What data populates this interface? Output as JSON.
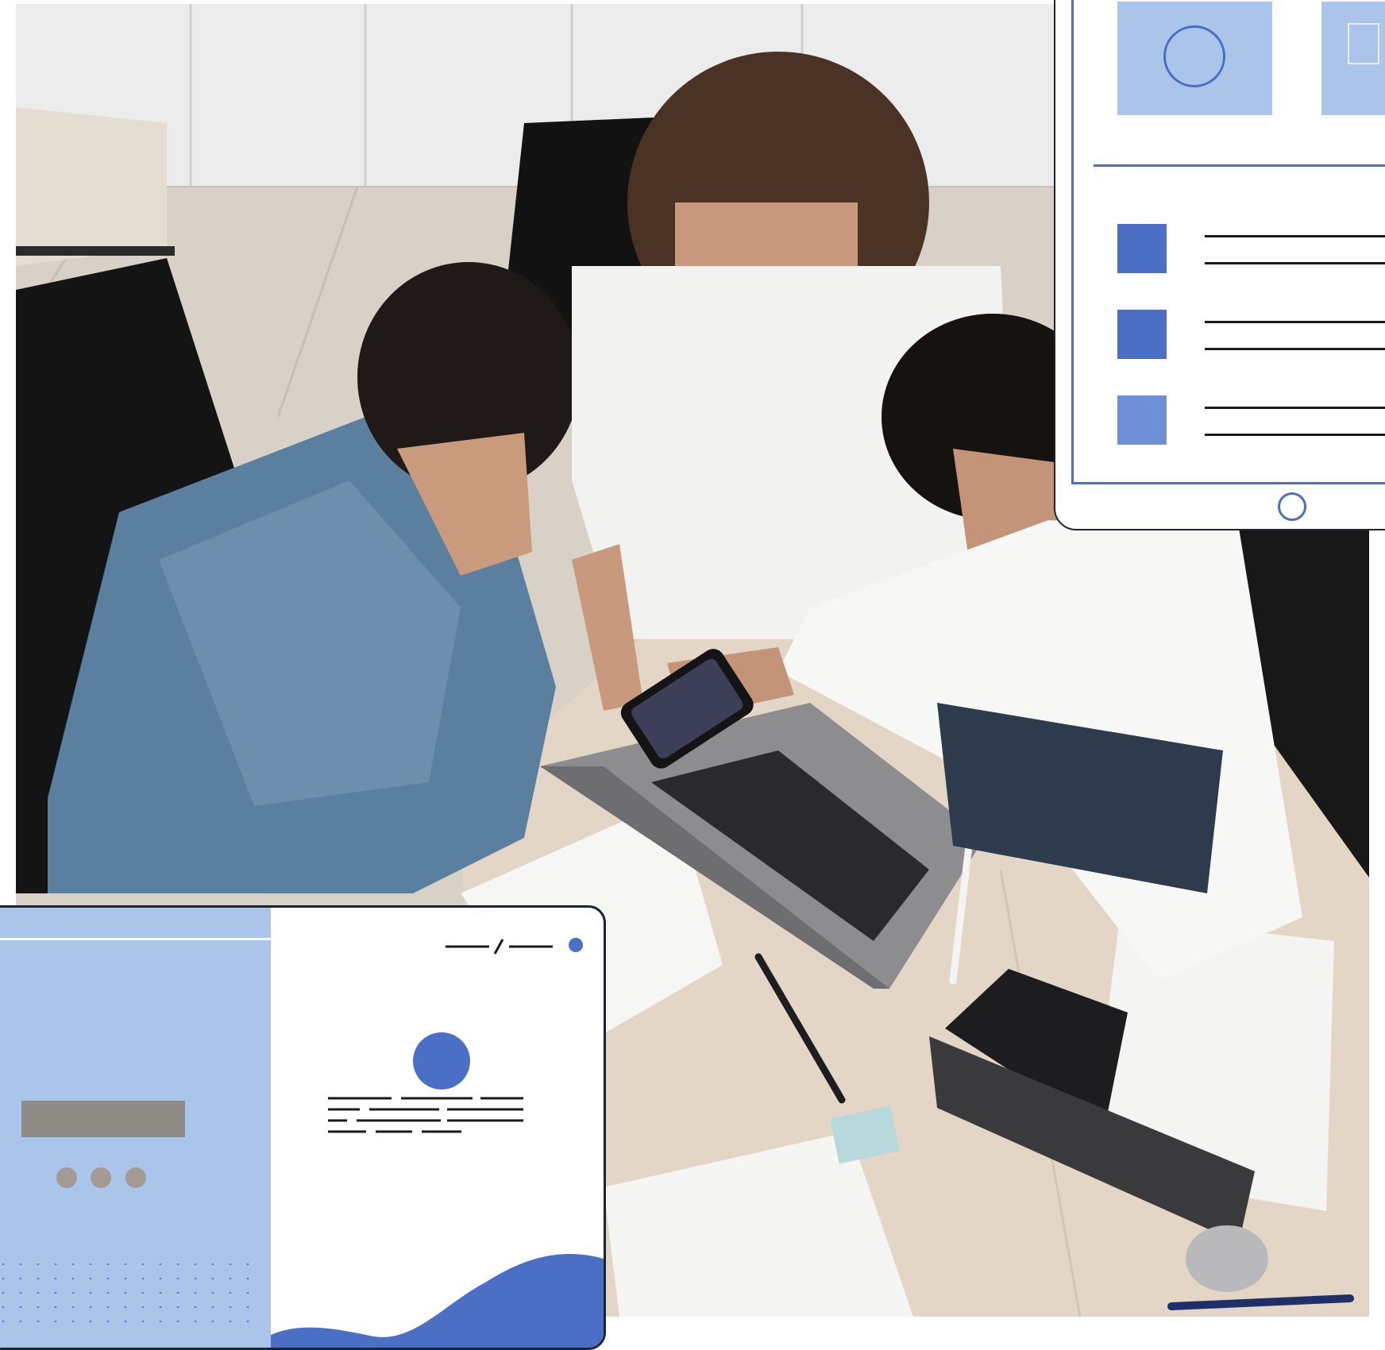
{
  "scene": {
    "description_tags": [
      "office-meeting-photo",
      "tablet-mockup",
      "laptop-mockup"
    ]
  },
  "colors": {
    "accent_blue": "#4b6fc4",
    "light_blue": "#aac5e9",
    "ink": "#1b1b1b",
    "frame": "#1d2330"
  },
  "tablet_mockup": {
    "rows": [
      {
        "square_color": "#4b6fc4"
      },
      {
        "square_color": "#4b6fc4"
      },
      {
        "square_color": "#6f8fd6"
      }
    ]
  },
  "laptop_mockup": {
    "dot_colors": [
      "#a39a93",
      "#a39a93",
      "#a39a93"
    ]
  }
}
